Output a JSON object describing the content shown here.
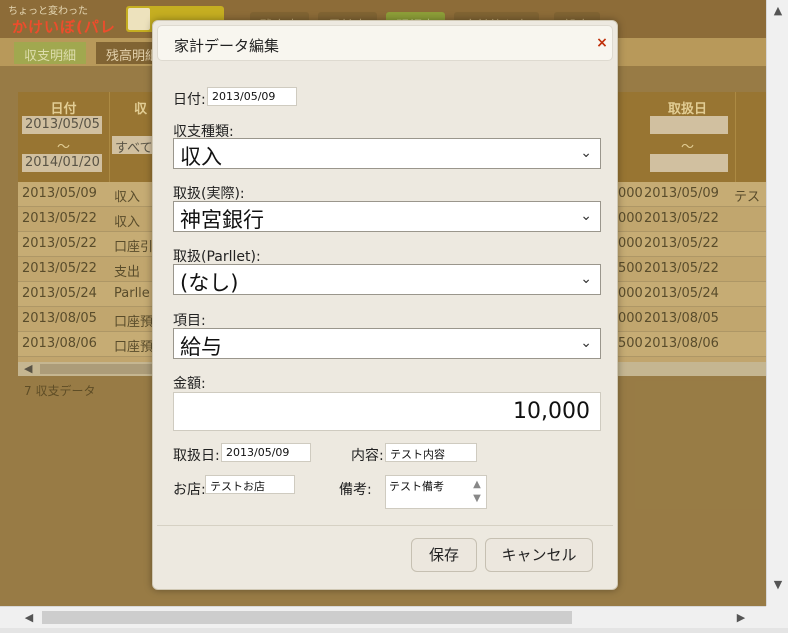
{
  "app": {
    "logo_small": "ちょっと変わった",
    "logo_main": "かけいぼ(パレット)版",
    "nav": [
      "残高表",
      "日計表",
      "明細表",
      "家計簿入力",
      "設定"
    ],
    "subtabs": [
      "収支明細",
      "残高明細"
    ]
  },
  "grid": {
    "headers": {
      "date": "日付",
      "date_from": "2013/05/05",
      "date_to": "2014/01/20",
      "kind_partial": "収",
      "kind_filter": "すべて",
      "handled_date": "取扱日",
      "tilde": "～"
    },
    "rows": [
      {
        "date": "2013/05/09",
        "kind": "収入",
        "amount_tail": "000",
        "hdate": "2013/05/09",
        "note": "テス"
      },
      {
        "date": "2013/05/22",
        "kind": "収入",
        "amount_tail": "000",
        "hdate": "2013/05/22",
        "note": ""
      },
      {
        "date": "2013/05/22",
        "kind": "口座引",
        "amount_tail": "000",
        "hdate": "2013/05/22",
        "note": ""
      },
      {
        "date": "2013/05/22",
        "kind": "支出",
        "amount_tail": "500",
        "hdate": "2013/05/22",
        "note": ""
      },
      {
        "date": "2013/05/24",
        "kind": "Parlle",
        "amount_tail": "000",
        "hdate": "2013/05/24",
        "note": ""
      },
      {
        "date": "2013/08/05",
        "kind": "口座預",
        "amount_tail": "000",
        "hdate": "2013/08/05",
        "note": ""
      },
      {
        "date": "2013/08/06",
        "kind": "口座預",
        "amount_tail": "500",
        "hdate": "2013/08/06",
        "note": ""
      }
    ],
    "count_text": "7 収支データ"
  },
  "dialog": {
    "title": "家計データ編集",
    "close_glyph": "×",
    "date_label": "日付:",
    "date_value": "2013/05/09",
    "type_label": "収支種類:",
    "type_value": "収入",
    "actual_label": "取扱(実際):",
    "actual_value": "神宮銀行",
    "parllet_label": "取扱(Parllet):",
    "parllet_value": "(なし)",
    "item_label": "項目:",
    "item_value": "給与",
    "amount_label": "金額:",
    "amount_value": "10,000",
    "hdate_label": "取扱日:",
    "hdate_value": "2013/05/09",
    "content_label": "内容:",
    "content_value": "テスト内容",
    "shop_label": "お店:",
    "shop_value": "テストお店",
    "memo_label": "備考:",
    "memo_value": "テスト備考",
    "save_label": "保存",
    "cancel_label": "キャンセル"
  },
  "icons": {
    "chevron": "chevron-down-icon",
    "close": "close-icon",
    "spin": "spinner-icon"
  },
  "colors": {
    "header_brown": "#7a5520",
    "active_tab_green": "#7a9a20",
    "close_red": "#c0300a"
  }
}
